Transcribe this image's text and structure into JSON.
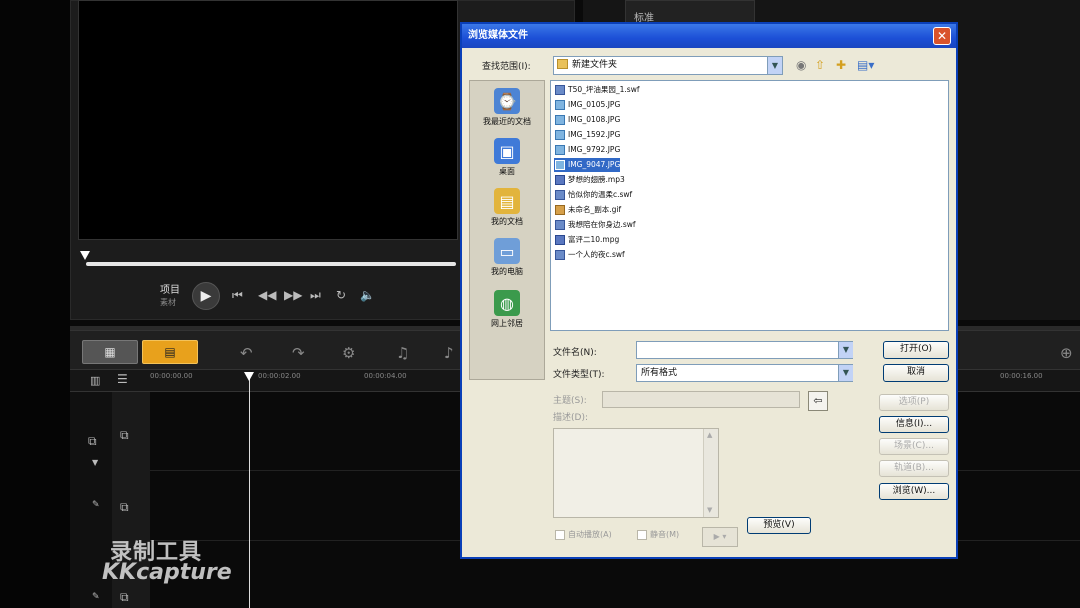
{
  "editor": {
    "control_label_top": "项目",
    "control_label_bottom": "素材",
    "timeline_times": [
      "00:00:00.00",
      "00:00:02.00",
      "00:00:04.00",
      "00:00:16.00"
    ],
    "right_tab_label": "标准",
    "watermark_line1": "录制工具",
    "watermark_line2": "KKcapture"
  },
  "dialog": {
    "title": "浏览媒体文件",
    "close_glyph": "✕",
    "look_in_label": "查找范围(I):",
    "look_in_value": "新建文件夹",
    "places": [
      {
        "label": "我最近的文档",
        "icon": "recent-documents-icon"
      },
      {
        "label": "桌面",
        "icon": "desktop-icon"
      },
      {
        "label": "我的文档",
        "icon": "my-documents-icon"
      },
      {
        "label": "我的电脑",
        "icon": "my-computer-icon"
      },
      {
        "label": "网上邻居",
        "icon": "network-places-icon"
      }
    ],
    "files": [
      {
        "name": "T50_坪油果园_1.swf",
        "type": "flash"
      },
      {
        "name": "IMG_0105.JPG",
        "type": "image"
      },
      {
        "name": "IMG_0108.JPG",
        "type": "image"
      },
      {
        "name": "IMG_1592.JPG",
        "type": "image"
      },
      {
        "name": "IMG_9792.JPG",
        "type": "image"
      },
      {
        "name": "IMG_9047.JPG",
        "type": "image",
        "selected": true
      },
      {
        "name": "梦想的翅膀.mp3",
        "type": "audio"
      },
      {
        "name": "恰似你的温柔c.swf",
        "type": "flash"
      },
      {
        "name": "未命名_副本.gif",
        "type": "gif"
      },
      {
        "name": "我想陪在你身边.swf",
        "type": "flash"
      },
      {
        "name": "富评二10.mpg",
        "type": "video"
      },
      {
        "name": "一个人的夜c.swf",
        "type": "flash"
      }
    ],
    "filename_label": "文件名(N):",
    "filename_value": "",
    "filetype_label": "文件类型(T):",
    "filetype_value": "所有格式",
    "subject_label": "主题(S):",
    "description_label": "描述(D):",
    "autoplay_label": "自动播放(A)",
    "mute_label": "静音(M)",
    "play_button": "▶ ▾",
    "buttons": {
      "open": "打开(O)",
      "cancel": "取消",
      "options": "选项(P)",
      "info": "信息(I)...",
      "scene": "场景(C)...",
      "browse_scene": "轨道(B)...",
      "browse": "浏览(W)...",
      "preview": "预览(V)"
    }
  },
  "colors": {
    "accent_orange": "#e8a11c",
    "xp_title_blue": "#1c4fd6",
    "selection_blue": "#3169c6"
  }
}
